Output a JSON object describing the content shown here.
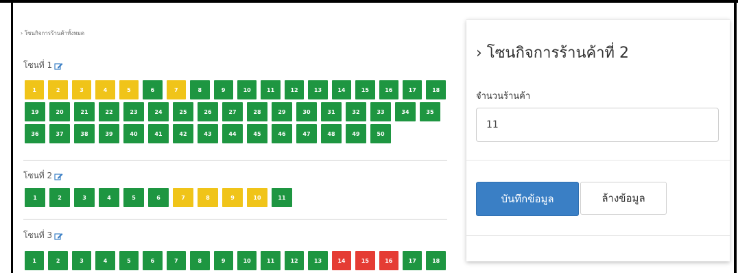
{
  "breadcrumb": "› โซนกิจการร้านค้าทั้งหมด",
  "zones": [
    {
      "title": "โซนที่ 1",
      "shops": [
        {
          "n": "1",
          "status": "pending"
        },
        {
          "n": "2",
          "status": "pending"
        },
        {
          "n": "3",
          "status": "pending"
        },
        {
          "n": "4",
          "status": "pending"
        },
        {
          "n": "5",
          "status": "pending"
        },
        {
          "n": "6",
          "status": "free"
        },
        {
          "n": "7",
          "status": "pending"
        },
        {
          "n": "8",
          "status": "free"
        },
        {
          "n": "9",
          "status": "free"
        },
        {
          "n": "10",
          "status": "free"
        },
        {
          "n": "11",
          "status": "free"
        },
        {
          "n": "12",
          "status": "free"
        },
        {
          "n": "13",
          "status": "free"
        },
        {
          "n": "14",
          "status": "free"
        },
        {
          "n": "15",
          "status": "free"
        },
        {
          "n": "16",
          "status": "free"
        },
        {
          "n": "17",
          "status": "free"
        },
        {
          "n": "18",
          "status": "free"
        },
        {
          "n": "19",
          "status": "free"
        },
        {
          "n": "20",
          "status": "free"
        },
        {
          "n": "21",
          "status": "free"
        },
        {
          "n": "22",
          "status": "free"
        },
        {
          "n": "23",
          "status": "free"
        },
        {
          "n": "24",
          "status": "free"
        },
        {
          "n": "25",
          "status": "free"
        },
        {
          "n": "26",
          "status": "free"
        },
        {
          "n": "27",
          "status": "free"
        },
        {
          "n": "28",
          "status": "free"
        },
        {
          "n": "29",
          "status": "free"
        },
        {
          "n": "30",
          "status": "free"
        },
        {
          "n": "31",
          "status": "free"
        },
        {
          "n": "32",
          "status": "free"
        },
        {
          "n": "33",
          "status": "free"
        },
        {
          "n": "34",
          "status": "free"
        },
        {
          "n": "35",
          "status": "free"
        },
        {
          "n": "36",
          "status": "free"
        },
        {
          "n": "37",
          "status": "free"
        },
        {
          "n": "38",
          "status": "free"
        },
        {
          "n": "39",
          "status": "free"
        },
        {
          "n": "40",
          "status": "free"
        },
        {
          "n": "41",
          "status": "free"
        },
        {
          "n": "42",
          "status": "free"
        },
        {
          "n": "43",
          "status": "free"
        },
        {
          "n": "44",
          "status": "free"
        },
        {
          "n": "45",
          "status": "free"
        },
        {
          "n": "46",
          "status": "free"
        },
        {
          "n": "47",
          "status": "free"
        },
        {
          "n": "48",
          "status": "free"
        },
        {
          "n": "49",
          "status": "free"
        },
        {
          "n": "50",
          "status": "free"
        }
      ]
    },
    {
      "title": "โซนที่ 2",
      "shops": [
        {
          "n": "1",
          "status": "free"
        },
        {
          "n": "2",
          "status": "free"
        },
        {
          "n": "3",
          "status": "free"
        },
        {
          "n": "4",
          "status": "free"
        },
        {
          "n": "5",
          "status": "free"
        },
        {
          "n": "6",
          "status": "free"
        },
        {
          "n": "7",
          "status": "pending"
        },
        {
          "n": "8",
          "status": "pending"
        },
        {
          "n": "9",
          "status": "pending"
        },
        {
          "n": "10",
          "status": "pending"
        },
        {
          "n": "11",
          "status": "free"
        }
      ]
    },
    {
      "title": "โซนที่ 3",
      "shops": [
        {
          "n": "1",
          "status": "free"
        },
        {
          "n": "2",
          "status": "free"
        },
        {
          "n": "3",
          "status": "free"
        },
        {
          "n": "4",
          "status": "free"
        },
        {
          "n": "5",
          "status": "free"
        },
        {
          "n": "6",
          "status": "free"
        },
        {
          "n": "7",
          "status": "free"
        },
        {
          "n": "8",
          "status": "free"
        },
        {
          "n": "9",
          "status": "free"
        },
        {
          "n": "10",
          "status": "free"
        },
        {
          "n": "11",
          "status": "free"
        },
        {
          "n": "12",
          "status": "free"
        },
        {
          "n": "13",
          "status": "free"
        },
        {
          "n": "14",
          "status": "busy"
        },
        {
          "n": "15",
          "status": "busy"
        },
        {
          "n": "16",
          "status": "busy"
        },
        {
          "n": "17",
          "status": "free"
        },
        {
          "n": "18",
          "status": "free"
        }
      ]
    }
  ],
  "status_colors": {
    "free": "#1e9641",
    "pending": "#f0c419",
    "busy": "#e53c34"
  },
  "icons": {
    "edit": "edit-icon"
  },
  "form": {
    "title": "› โซนกิจการร้านค้าที่ 2",
    "count_label": "จำนวนร้านค้า",
    "count_value": "11",
    "save_label": "บันทึกข้อมูล",
    "clear_label": "ล้างข้อมูล"
  }
}
